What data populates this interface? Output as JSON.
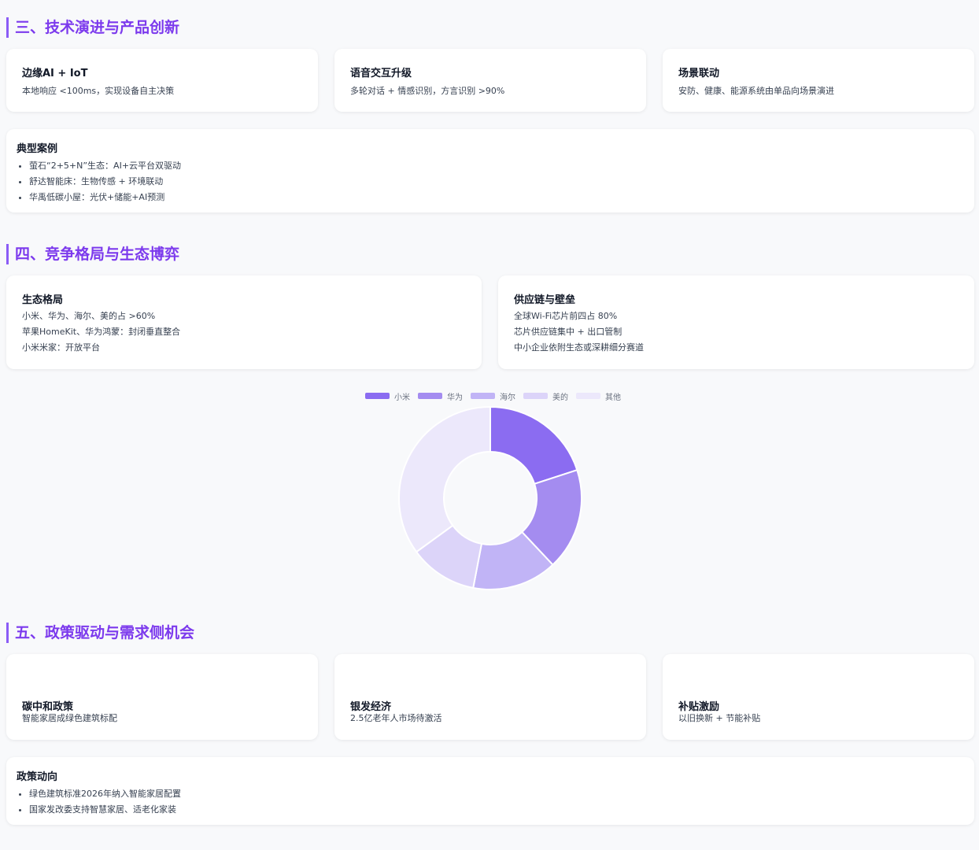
{
  "section3": {
    "title": "三、技术演进与产品创新",
    "cards": [
      {
        "title": "边缘AI + IoT",
        "desc": "本地响应 <100ms，实现设备自主决策"
      },
      {
        "title": "语音交互升级",
        "desc": "多轮对话 + 情感识别，方言识别 >90%"
      },
      {
        "title": "场景联动",
        "desc": "安防、健康、能源系统由单品向场景演进"
      }
    ],
    "cases": {
      "title": "典型案例",
      "items": [
        "萤石“2+5+N”生态：AI+云平台双驱动",
        "舒达智能床：生物传感 + 环境联动",
        "华禹低碳小屋：光伏+储能+AI预测"
      ]
    }
  },
  "section4": {
    "title": "四、竞争格局与生态博弈",
    "cards": [
      {
        "title": "生态格局",
        "lines": [
          "小米、华为、海尔、美的占 >60%",
          "苹果HomeKit、华为鸿蒙：封闭垂直整合",
          "小米米家：开放平台"
        ]
      },
      {
        "title": "供应链与壁垒",
        "lines": [
          "全球Wi-Fi芯片前四占 80%",
          "芯片供应链集中 + 出口管制",
          "中小企业依附生态或深耕细分赛道"
        ]
      }
    ]
  },
  "chart_data": {
    "type": "pie",
    "title": "",
    "legend_position": "top",
    "labels": [
      "小米",
      "华为",
      "海尔",
      "美的",
      "其他"
    ],
    "values": [
      20,
      18,
      15,
      12,
      35
    ],
    "colors": [
      "#8b6cf1",
      "#a48cf0",
      "#c1b4f6",
      "#dcd4f9",
      "#ece8fb"
    ]
  },
  "section5": {
    "title": "五、政策驱动与需求侧机会",
    "cards": [
      {
        "title": "碳中和政策",
        "desc": "智能家居成绿色建筑标配"
      },
      {
        "title": "银发经济",
        "desc": "2.5亿老年人市场待激活"
      },
      {
        "title": "补贴激励",
        "desc": "以旧换新 + 节能补贴"
      }
    ],
    "policy": {
      "title": "政策动向",
      "items": [
        "绿色建筑标准2026年纳入智能家居配置",
        "国家发改委支持智慧家居、适老化家装"
      ]
    }
  }
}
